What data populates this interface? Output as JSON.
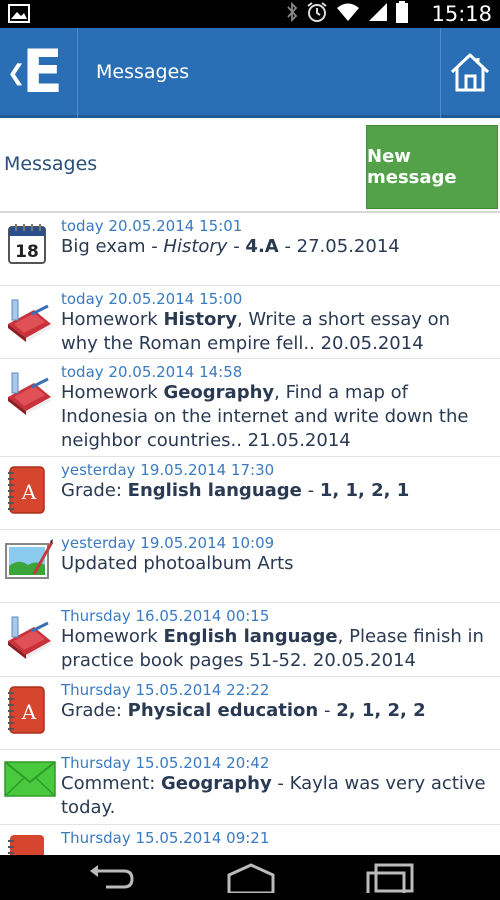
{
  "status_bar": {
    "time": "15:18",
    "icons": [
      "gallery-icon",
      "bluetooth-icon",
      "alarm-icon",
      "wifi-icon",
      "signal-icon",
      "battery-icon"
    ]
  },
  "app_bar": {
    "logo": "E",
    "title": "Messages"
  },
  "header": {
    "label": "Messages",
    "new_message_button": "New message"
  },
  "messages": [
    {
      "icon": "calendar-icon",
      "date": "today 20.05.2014 15:01",
      "segments": [
        {
          "t": "Big exam  - ",
          "s": "n"
        },
        {
          "t": "History",
          "s": "i"
        },
        {
          "t": " - ",
          "s": "n"
        },
        {
          "t": "4.A",
          "s": "b"
        },
        {
          "t": " - 27.05.2014",
          "s": "n"
        }
      ]
    },
    {
      "icon": "homework-book-icon",
      "date": "today 20.05.2014 15:00",
      "segments": [
        {
          "t": "Homework ",
          "s": "n"
        },
        {
          "t": "History",
          "s": "b"
        },
        {
          "t": ", Write a short essay on why the Roman empire fell.. 20.05.2014",
          "s": "n"
        }
      ]
    },
    {
      "icon": "homework-book-icon",
      "date": "today 20.05.2014 14:58",
      "segments": [
        {
          "t": "Homework ",
          "s": "n"
        },
        {
          "t": "Geography",
          "s": "b"
        },
        {
          "t": ", Find a map of Indonesia on the internet and write down the neighbor countries.. 21.05.2014",
          "s": "n"
        }
      ]
    },
    {
      "icon": "grade-book-icon",
      "date": "yesterday 19.05.2014 17:30",
      "segments": [
        {
          "t": "Grade: ",
          "s": "n"
        },
        {
          "t": "English language",
          "s": "b"
        },
        {
          "t": " - ",
          "s": "n"
        },
        {
          "t": "1, 1, 2, 1",
          "s": "b"
        }
      ]
    },
    {
      "icon": "photo-album-icon",
      "date": "yesterday 19.05.2014 10:09",
      "segments": [
        {
          "t": "Updated photoalbum Arts",
          "s": "n"
        }
      ]
    },
    {
      "icon": "homework-book-icon",
      "date": "Thursday 16.05.2014 00:15",
      "segments": [
        {
          "t": "Homework ",
          "s": "n"
        },
        {
          "t": "English language",
          "s": "b"
        },
        {
          "t": ", Please finish in practice book pages 51-52. 20.05.2014",
          "s": "n"
        }
      ]
    },
    {
      "icon": "grade-book-icon",
      "date": "Thursday 15.05.2014 22:22",
      "segments": [
        {
          "t": "Grade: ",
          "s": "n"
        },
        {
          "t": "Physical education",
          "s": "b"
        },
        {
          "t": " - ",
          "s": "n"
        },
        {
          "t": "2, 1, 2, 2",
          "s": "b"
        }
      ]
    },
    {
      "icon": "envelope-icon",
      "date": "Thursday 15.05.2014 20:42",
      "segments": [
        {
          "t": "Comment: ",
          "s": "n"
        },
        {
          "t": "Geography",
          "s": "b"
        },
        {
          "t": " - Kayla was very active today.",
          "s": "n"
        }
      ]
    },
    {
      "icon": "grade-book-icon",
      "date": "Thursday 15.05.2014 09:21",
      "segments": []
    }
  ],
  "nav_bar": {
    "buttons": [
      "back-icon",
      "home-icon",
      "recent-apps-icon"
    ]
  },
  "colors": {
    "app_bar": "#2a6fb5",
    "new_message_button": "#53a24a",
    "date_text": "#3a7bc1",
    "body_text": "#2a3a52"
  }
}
